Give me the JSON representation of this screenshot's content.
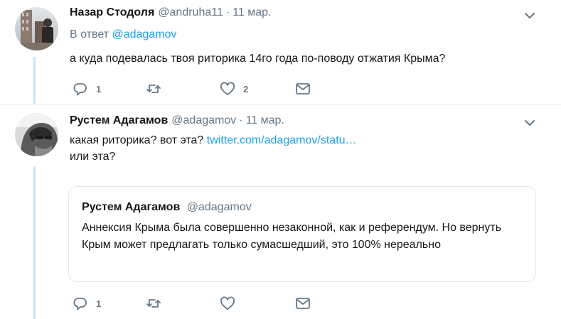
{
  "colors": {
    "accent": "#1da1f2",
    "muted": "#657786",
    "thread_line": "#c4e5f9",
    "border": "#e1e8ed"
  },
  "tweet1": {
    "name": "Назар Стодоля",
    "handle": "@andruha11",
    "separator": "·",
    "date": "11 мар.",
    "reply_prefix": "В ответ",
    "reply_to": "@adagamov",
    "text": "а куда подевалась твоя риторика 14го года по-поводу отжатия Крыма?",
    "reply_count": "1",
    "retweet_count": "",
    "like_count": "2",
    "icons": [
      "reply-icon",
      "retweet-icon",
      "like-icon",
      "direct-message-icon",
      "chevron-down-icon"
    ]
  },
  "tweet2": {
    "name": "Рустем Адагамов",
    "handle": "@adagamov",
    "separator": "·",
    "date": "11 мар.",
    "text_line1": "какая риторика? вот эта?",
    "link": "twitter.com/adagamov/statu…",
    "text_line2": "или эта?",
    "reply_count": "1",
    "retweet_count": "",
    "like_count": "",
    "quote": {
      "name": "Рустем Адагамов",
      "handle": "@adagamov",
      "text": "Аннексия Крыма была совершенно незаконной, как и референдум. Но вернуть Крым может предлагать только сумасшедший, это 100% нереально"
    }
  }
}
